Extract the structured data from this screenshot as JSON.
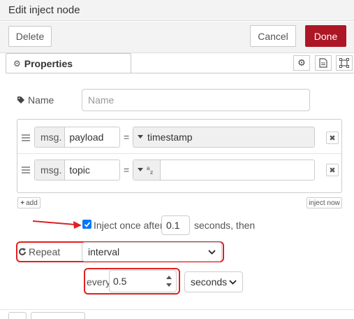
{
  "header": {
    "title": "Edit inject node"
  },
  "toolbar": {
    "delete_label": "Delete",
    "cancel_label": "Cancel",
    "done_label": "Done"
  },
  "tabs": {
    "properties_label": "Properties"
  },
  "name_field": {
    "label": "Name",
    "placeholder": "Name",
    "value": ""
  },
  "props": [
    {
      "prefix": "msg.",
      "key": "payload",
      "op": "=",
      "type_icon": "caret-down-icon",
      "value": "timestamp"
    },
    {
      "prefix": "msg.",
      "key": "topic",
      "op": "=",
      "type_icon": "string-type-icon",
      "value": ""
    }
  ],
  "list_actions": {
    "add_label": "add",
    "inject_now_label": "inject now"
  },
  "inject_once": {
    "checked": true,
    "label": "Inject once after",
    "delay": "0.1",
    "suffix": "seconds, then"
  },
  "repeat": {
    "label": "Repeat",
    "mode": "interval"
  },
  "every": {
    "label": "every",
    "value": "0.5",
    "unit": "seconds"
  },
  "colors": {
    "done_bg": "#ad1625",
    "annotation": "#e02020"
  }
}
